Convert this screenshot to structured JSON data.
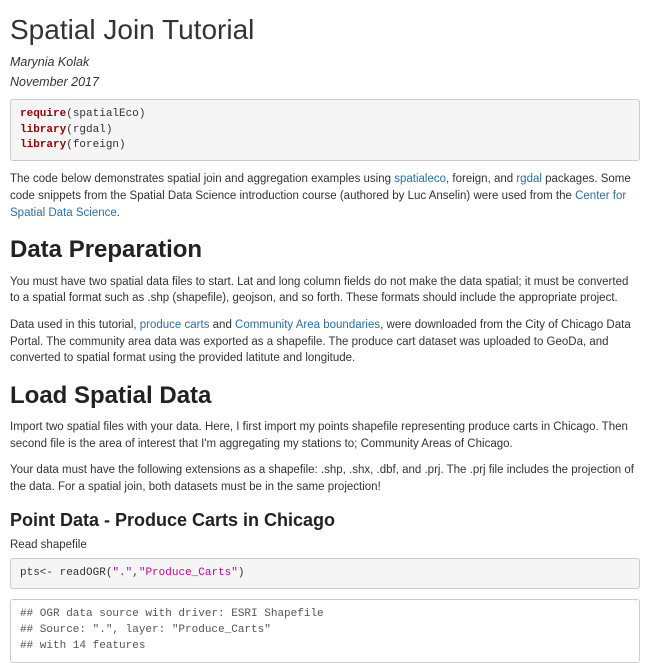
{
  "title": "Spatial Join Tutorial",
  "author": "Marynia Kolak",
  "date": "November 2017",
  "code1": {
    "l1_kw": "require",
    "l1_rest": "(spatialEco)",
    "l2_kw": "library",
    "l2_rest": "(rgdal)",
    "l3_kw": "library",
    "l3_rest": "(foreign)"
  },
  "intro": {
    "t1": "The code below demonstrates spatial join and aggregation examples using ",
    "link1": "spatialeco",
    "t2": ", foreign, and ",
    "link2": "rgdal",
    "t3": " packages. Some code snippets from the Spatial Data Science introduction course (authored by Luc Anselin) were used from the ",
    "link3": "Center for Spatial Data Science",
    "t4": "."
  },
  "sec1": {
    "heading": "Data Preparation",
    "p1": "You must have two spatial data files to start. Lat and long column fields do not make the data spatial; it must be converted to a spatial format such as .shp (shapefile), geojson, and so forth. These formats should include the appropriate project.",
    "p2a": "Data used in this tutorial, ",
    "link1": "produce carts",
    "p2b": " and ",
    "link2": "Community Area boundaries",
    "p2c": ", were downloaded from the City of Chicago Data Portal. The community area data was exported as a shapefile. The produce cart dataset was uploaded to GeoDa, and converted to spatial format using the provided latitute and longitude."
  },
  "sec2": {
    "heading": "Load Spatial Data",
    "p1": "Import two spatial files with your data. Here, I first import my points shapefile representing produce carts in Chicago. Then second file is the area of interest that I'm aggregating my stations to; Community Areas of Chicago.",
    "p2": "Your data must have the following extensions as a shapefile: .shp, .shx, .dbf, and .prj. The .prj file includes the projection of the data. For a spatial join, both datasets must be in the same projection!"
  },
  "sec3": {
    "heading": "Point Data - Produce Carts in Chicago",
    "label": "Read shapefile"
  },
  "code2": {
    "lhs": "pts<- ",
    "fn": "readOGR",
    "open": "(",
    "s1": "\".\"",
    "comma": ",",
    "s2": "\"Produce_Carts\"",
    "close": ")"
  },
  "output": "## OGR data source with driver: ESRI Shapefile \n## Source: \".\", layer: \"Produce_Carts\"\n## with 14 features"
}
